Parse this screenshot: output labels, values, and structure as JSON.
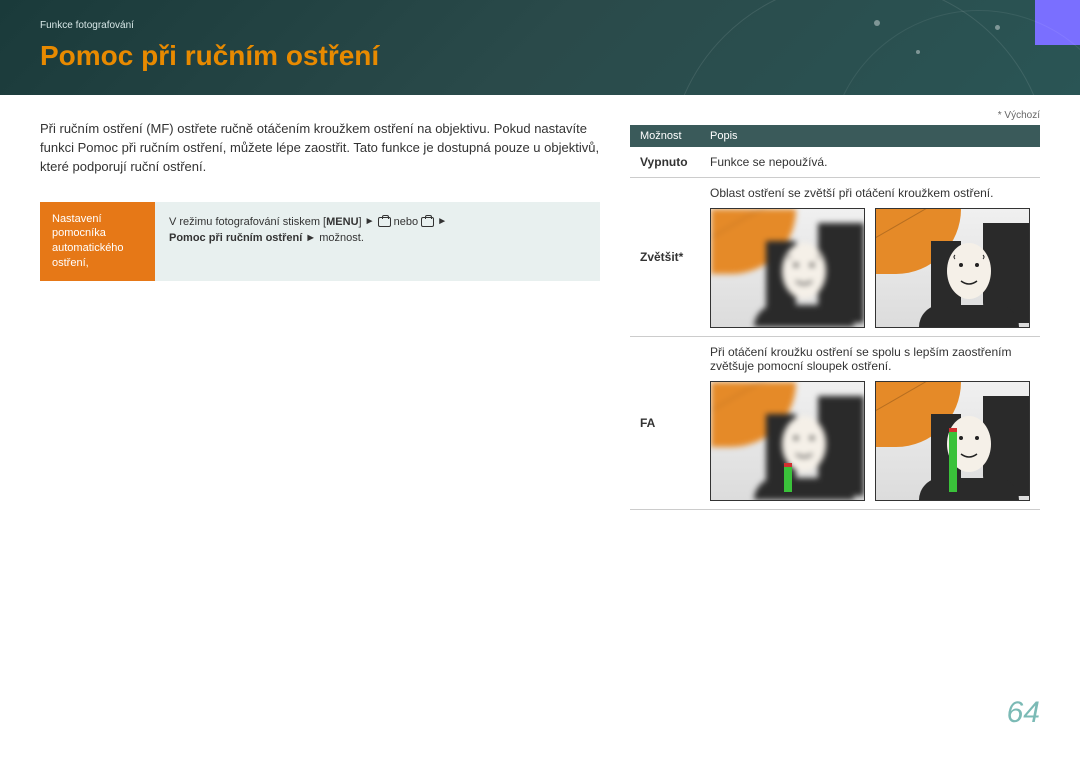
{
  "breadcrumb": "Funkce fotografování",
  "title": "Pomoc při ručním ostření",
  "intro": "Při ručním ostření (MF) ostřete ručně otáčením kroužkem ostření na objektivu. Pokud nastavíte funkci Pomoc při ručním ostření, můžete lépe zaostřit. Tato funkce je dostupná pouze u objektivů, které podporují ruční ostření.",
  "setting": {
    "label": "Nastavení pomocníka automatického ostření,",
    "body_prefix": "V režimu fotografování stiskem [",
    "menu": "MENU",
    "body_mid1": "] ",
    "or": "nebo",
    "body_mid2": " ",
    "line2_bold": "Pomoc při ručním ostření",
    "line2_tail": " ► možnost."
  },
  "default_note": "* Výchozí",
  "table": {
    "head_option": "Možnost",
    "head_desc": "Popis",
    "rows": [
      {
        "name": "Vypnuto",
        "desc": "Funkce se nepoužívá."
      },
      {
        "name": "Zvětšit*",
        "desc": "Oblast ostření se zvětší při otáčení kroužkem ostření."
      },
      {
        "name": "FA",
        "desc": "Při otáčení kroužku ostření se spolu s lepším zaostřením zvětšuje pomocní sloupek ostření."
      }
    ]
  },
  "page_number": "64"
}
